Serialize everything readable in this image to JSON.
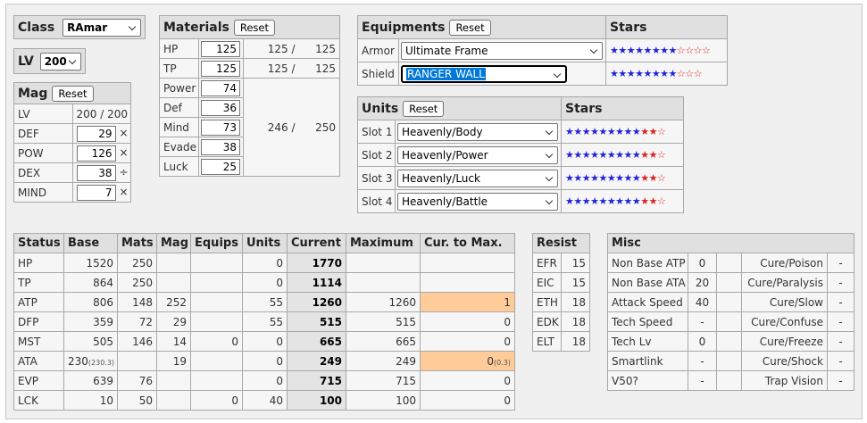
{
  "class_block": {
    "label": "Class",
    "value": "RAmar"
  },
  "lv_block": {
    "label": "LV",
    "value": "200"
  },
  "mag": {
    "title": "Mag",
    "reset": "Reset",
    "lv_label": "LV",
    "lv_value": "200 / 200",
    "rows": [
      {
        "label": "DEF",
        "value": "29",
        "mult": "× 1"
      },
      {
        "label": "POW",
        "value": "126",
        "mult": "× 2"
      },
      {
        "label": "DEX",
        "value": "38",
        "mult": "÷ 2"
      },
      {
        "label": "MIND",
        "value": "7",
        "mult": "× 2"
      }
    ]
  },
  "materials": {
    "title": "Materials",
    "reset": "Reset",
    "hp": {
      "label": "HP",
      "value": "125",
      "summary": "125 /",
      "max": "125"
    },
    "tp": {
      "label": "TP",
      "value": "125",
      "summary": "125 /",
      "max": "125"
    },
    "rows": [
      {
        "label": "Power",
        "value": "74"
      },
      {
        "label": "Def",
        "value": "36"
      },
      {
        "label": "Mind",
        "value": "73"
      },
      {
        "label": "Evade",
        "value": "38"
      },
      {
        "label": "Luck",
        "value": "25"
      }
    ],
    "total": "246 /",
    "total_max": "250"
  },
  "equipments": {
    "title": "Equipments",
    "reset": "Reset",
    "stars_header": "Stars",
    "rows": [
      {
        "label": "Armor",
        "value": "Ultimate Frame"
      },
      {
        "label": "Shield",
        "value": "RANGER WALL"
      }
    ]
  },
  "units": {
    "title": "Units",
    "reset": "Reset",
    "stars_header": "Stars",
    "rows": [
      {
        "label": "Slot 1",
        "value": "Heavenly/Body"
      },
      {
        "label": "Slot 2",
        "value": "Heavenly/Power"
      },
      {
        "label": "Slot 3",
        "value": "Heavenly/Luck"
      },
      {
        "label": "Slot 4",
        "value": "Heavenly/Battle"
      }
    ]
  },
  "stars": {
    "armor": {
      "blue": "★★★★★★★★",
      "red": "",
      "empty": "☆☆☆☆"
    },
    "shield": {
      "blue": "★★★★★★★★",
      "red": "",
      "empty": "☆☆☆"
    },
    "unit": {
      "blue": "★★★★★★★★★",
      "red": "★★",
      "empty": "☆"
    }
  },
  "status": {
    "headers": [
      "Status",
      "Base",
      "Mats",
      "Mag",
      "Equips",
      "Units",
      "Current",
      "Maximum",
      "Cur. to Max."
    ],
    "rows": [
      {
        "name": "HP",
        "base": "1520",
        "base_sub": "",
        "mats": "250",
        "mag": "",
        "equips": "",
        "units": "0",
        "current": "1770",
        "maximum": "",
        "ctm": "",
        "ctm_sub": ""
      },
      {
        "name": "TP",
        "base": "864",
        "base_sub": "",
        "mats": "250",
        "mag": "",
        "equips": "",
        "units": "0",
        "current": "1114",
        "maximum": "",
        "ctm": "",
        "ctm_sub": ""
      },
      {
        "name": "ATP",
        "base": "806",
        "base_sub": "",
        "mats": "148",
        "mag": "252",
        "equips": "",
        "units": "55",
        "current": "1260",
        "maximum": "1260",
        "ctm": "1",
        "ctm_sub": ""
      },
      {
        "name": "DFP",
        "base": "359",
        "base_sub": "",
        "mats": "72",
        "mag": "29",
        "equips": "",
        "units": "55",
        "current": "515",
        "maximum": "515",
        "ctm": "0",
        "ctm_sub": ""
      },
      {
        "name": "MST",
        "base": "505",
        "base_sub": "",
        "mats": "146",
        "mag": "14",
        "equips": "0",
        "units": "0",
        "current": "665",
        "maximum": "665",
        "ctm": "0",
        "ctm_sub": ""
      },
      {
        "name": "ATA",
        "base": "230",
        "base_sub": "(230.3)",
        "mats": "",
        "mag": "19",
        "equips": "",
        "units": "0",
        "current": "249",
        "maximum": "249",
        "ctm": "0",
        "ctm_sub": "(0.3)"
      },
      {
        "name": "EVP",
        "base": "639",
        "base_sub": "",
        "mats": "76",
        "mag": "",
        "equips": "",
        "units": "0",
        "current": "715",
        "maximum": "715",
        "ctm": "0",
        "ctm_sub": ""
      },
      {
        "name": "LCK",
        "base": "10",
        "base_sub": "",
        "mats": "50",
        "mag": "",
        "equips": "0",
        "units": "40",
        "current": "100",
        "maximum": "100",
        "ctm": "0",
        "ctm_sub": ""
      }
    ]
  },
  "resist": {
    "title": "Resist",
    "rows": [
      {
        "name": "EFR",
        "value": "15"
      },
      {
        "name": "EIC",
        "value": "15"
      },
      {
        "name": "ETH",
        "value": "18"
      },
      {
        "name": "EDK",
        "value": "18"
      },
      {
        "name": "ELT",
        "value": "18"
      }
    ]
  },
  "misc": {
    "title": "Misc",
    "rows": [
      {
        "l": "Non Base ATP",
        "lv": "0",
        "r": "Cure/Poison",
        "rv": "-"
      },
      {
        "l": "Non Base ATA",
        "lv": "20",
        "r": "Cure/Paralysis",
        "rv": "-"
      },
      {
        "l": "Attack Speed",
        "lv": "40",
        "r": "Cure/Slow",
        "rv": "-"
      },
      {
        "l": "Tech Speed",
        "lv": "-",
        "r": "Cure/Confuse",
        "rv": "-"
      },
      {
        "l": "Tech Lv",
        "lv": "0",
        "r": "Cure/Freeze",
        "rv": "-"
      },
      {
        "l": "Smartlink",
        "lv": "-",
        "r": "Cure/Shock",
        "rv": "-"
      },
      {
        "l": "V50?",
        "lv": "-",
        "r": "Trap Vision",
        "rv": "-"
      }
    ]
  }
}
